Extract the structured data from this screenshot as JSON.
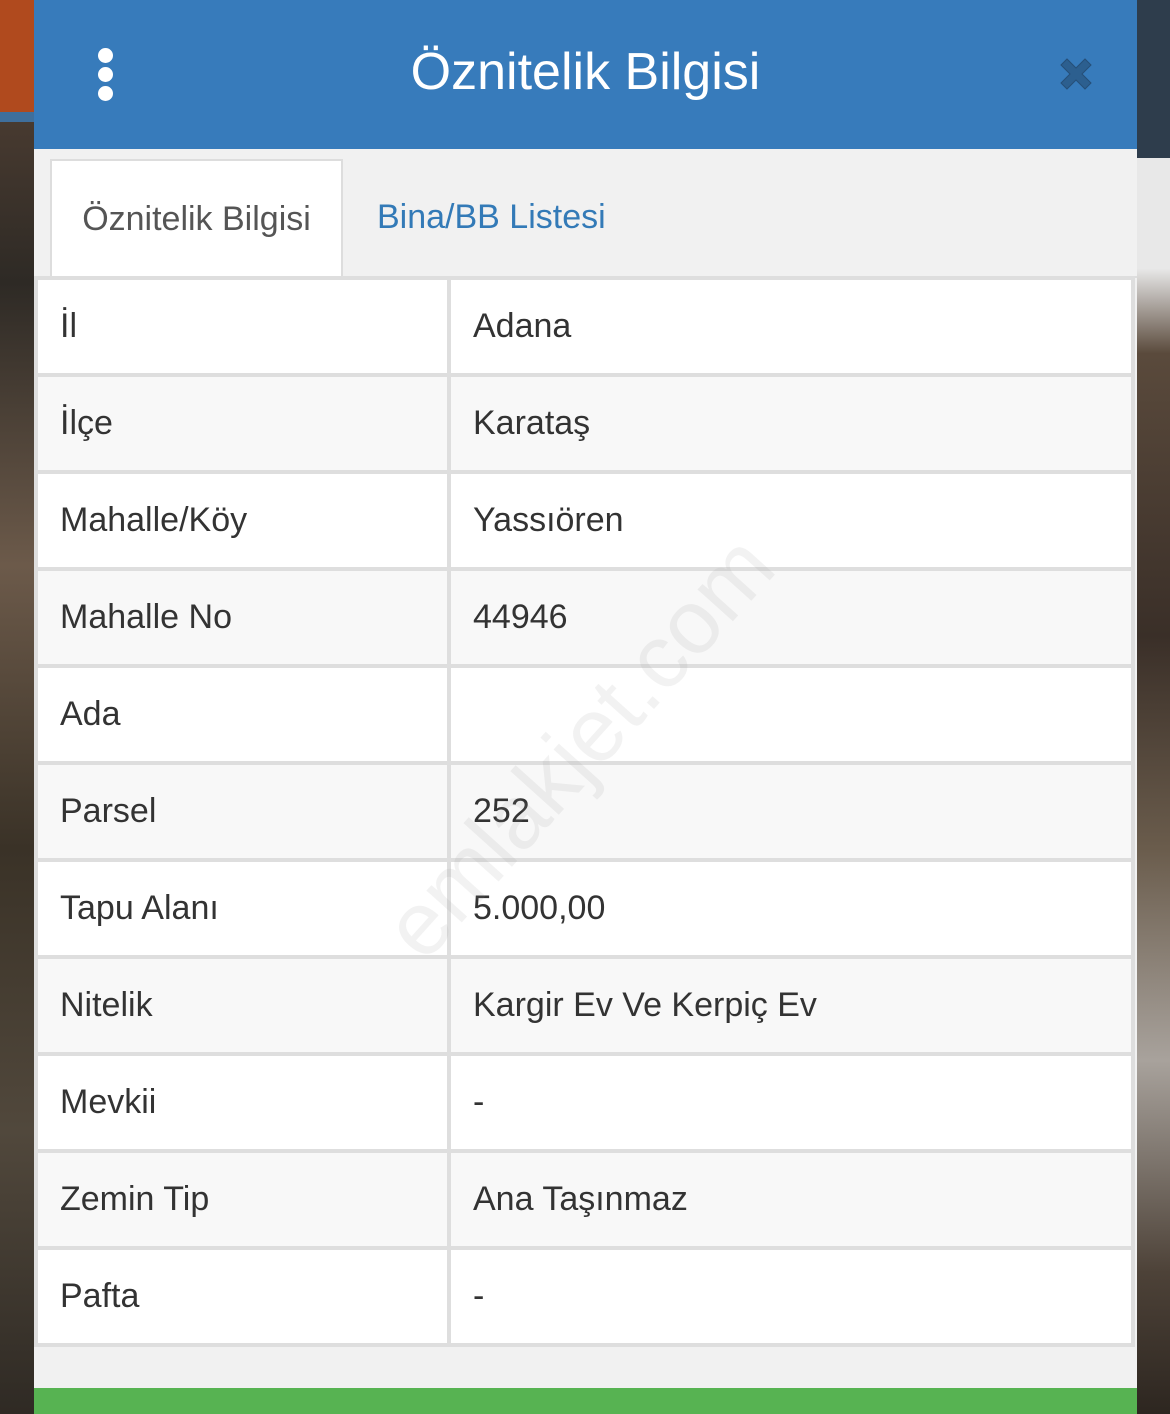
{
  "header": {
    "title": "Öznitelik Bilgisi",
    "menu_icon": "more-vertical-icon",
    "close_icon": "close-icon",
    "color": "#377bbb"
  },
  "tabs": [
    {
      "label": "Öznitelik Bilgisi",
      "active": true
    },
    {
      "label": "Bina/BB Listesi",
      "active": false
    }
  ],
  "rows": [
    {
      "key": "İl",
      "value": "Adana"
    },
    {
      "key": "İlçe",
      "value": "Karataş"
    },
    {
      "key": "Mahalle/Köy",
      "value": "Yassıören"
    },
    {
      "key": "Mahalle No",
      "value": "44946"
    },
    {
      "key": "Ada",
      "value": ""
    },
    {
      "key": "Parsel",
      "value": "252"
    },
    {
      "key": "Tapu Alanı",
      "value": "5.000,00"
    },
    {
      "key": "Nitelik",
      "value": "Kargir Ev Ve Kerpiç Ev"
    },
    {
      "key": "Mevkii",
      "value": "-"
    },
    {
      "key": "Zemin Tip",
      "value": "Ana Taşınmaz"
    },
    {
      "key": "Pafta",
      "value": "-"
    }
  ],
  "watermark": "emlakjet.com",
  "footer_color": "#57b352"
}
